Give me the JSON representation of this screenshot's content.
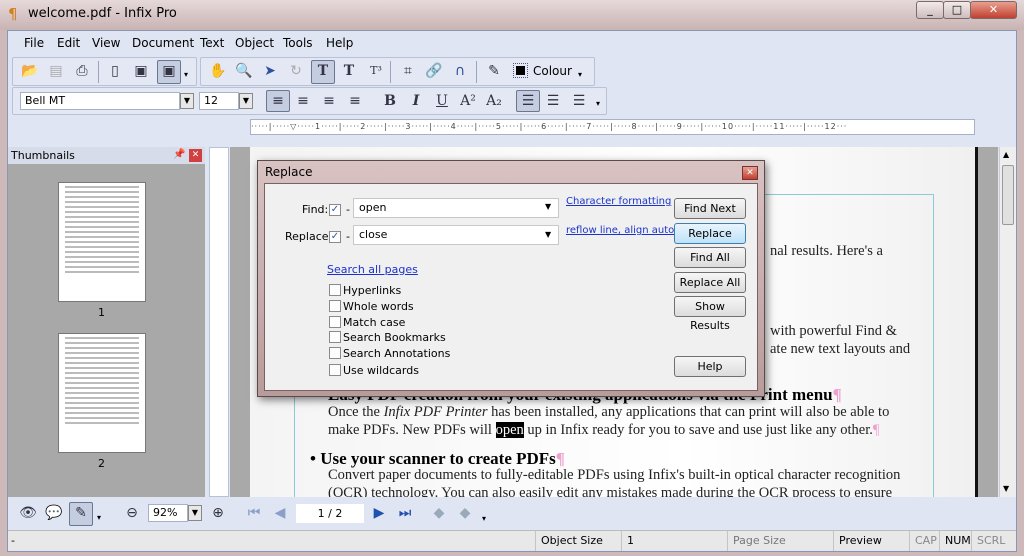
{
  "window": {
    "title": "welcome.pdf - Infix Pro",
    "controls": [
      "minimize",
      "maximize",
      "close"
    ]
  },
  "menu": [
    "File",
    "Edit",
    "View",
    "Document",
    "Text",
    "Object",
    "Tools",
    "Help"
  ],
  "toolbar": {
    "colour_label": "Colour",
    "font": "Bell MT",
    "size": "12"
  },
  "ruler": "·····|·····▽·····1·····|·····2·····|·····3·····|·····4·····|·····5·····|·····6·····|·····7·····|·····8·····|·····9·····|·····10·····|·····11·····|·····12···",
  "thumbnails": {
    "title": "Thumbnails",
    "pages": [
      "1",
      "2"
    ]
  },
  "document": {
    "frag1": "nal results. Here's a",
    "frag2": "with powerful Find &",
    "frag3": "ate new text layouts and",
    "heading1": "Easy PDF creation from your existing applications via the Print menu",
    "p1a_pre": "Once the ",
    "p1a_em": "Infix PDF Printer",
    "p1a_post": " has been installed, any applications that can print will also be able to",
    "p1b_pre": "make PDFs. New PDFs will ",
    "p1b_hl": "open",
    "p1b_post": " up in Infix ready for you to save and use just like any other.",
    "heading2": "Use your scanner to create PDFs",
    "p2a": "Convert paper documents to fully-editable PDFs using Infix's built-in optical character recognition",
    "p2b": "(OCR) technology. You can also easily edit any mistakes made during the OCR process to ensure",
    "pilcrow": "¶",
    "bullet": "•"
  },
  "dialog": {
    "title": "Replace",
    "find_label": "Find:",
    "find_value": "open",
    "find_checked": true,
    "replace_label": "Replace:",
    "replace_value": "close",
    "replace_checked": true,
    "dash": "-",
    "link_char": "Character formatting",
    "link_reflow": "reflow line, align auto",
    "link_search_all": "Search all pages",
    "options": [
      "Hyperlinks",
      "Whole words",
      "Match case",
      "Search Bookmarks",
      "Search Annotations",
      "Use wildcards"
    ],
    "buttons": [
      "Find Next",
      "Replace",
      "Find All",
      "Replace All",
      "Show Results",
      "Help"
    ]
  },
  "bottom": {
    "zoom": "92%",
    "page": "1 / 2"
  },
  "status": {
    "left": "-",
    "object_size_label": "Object Size",
    "object_size": "1",
    "page_size_label": "Page Size",
    "preview": "Preview",
    "cap": "CAP",
    "num": "NUM",
    "scrl": "SCRL"
  }
}
